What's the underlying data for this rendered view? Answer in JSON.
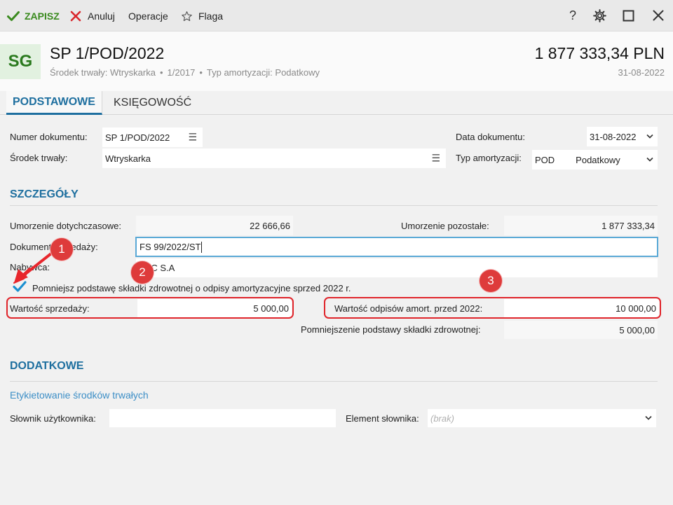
{
  "toolbar": {
    "save_label": "ZAPISZ",
    "cancel_label": "Anuluj",
    "operations_label": "Operacje",
    "flag_label": "Flaga",
    "help_label": "?"
  },
  "header": {
    "avatar_text": "SG",
    "title": "SP 1/POD/2022",
    "subtitle": {
      "asset": "Środek trwały: Wtryskarka",
      "period": "1/2017",
      "depreciation": "Typ amortyzacji: Podatkowy"
    },
    "amount": "1 877 333,34 PLN",
    "date": "31-08-2022"
  },
  "tabs": [
    {
      "label": "PODSTAWOWE",
      "active": true
    },
    {
      "label": "KSIĘGOWOŚĆ",
      "active": false
    }
  ],
  "form": {
    "doc_number_label": "Numer dokumentu:",
    "doc_number_value": "SP 1/POD/2022",
    "asset_label": "Środek trwały:",
    "asset_value": "Wtryskarka",
    "doc_date_label": "Data dokumentu:",
    "doc_date_value": "31-08-2022",
    "depr_type_label": "Typ amortyzacji:",
    "depr_type_code": "POD",
    "depr_type_value": "Podatkowy"
  },
  "details": {
    "section_title": "SZCZEGÓŁY",
    "depr_so_far_label": "Umorzenie dotychczasowe:",
    "depr_so_far_value": "22 666,66",
    "depr_remaining_label": "Umorzenie pozostałe:",
    "depr_remaining_value": "1 877 333,34",
    "sale_doc_label": "Dokument sprzedaży:",
    "sale_doc_value": "FS 99/2022/ST",
    "buyer_label": "Nabywca:",
    "buyer_value": "ABC S.A",
    "reduce_checkbox_label": "Pomniejsz podstawę składki zdrowotnej o odpisy amortyzacyjne sprzed 2022 r.",
    "reduce_checked": true,
    "sale_value_label": "Wartość sprzedaży:",
    "sale_value": "5 000,00",
    "pre2022_label": "Wartość odpisów amort. przed 2022:",
    "pre2022_value": "10 000,00",
    "health_reduction_label": "Pomniejszenie podstawy składki zdrowotnej:",
    "health_reduction_value": "5 000,00"
  },
  "additional": {
    "section_title": "DODATKOWE",
    "labeling_link": "Etykietowanie środków trwałych",
    "user_dict_label": "Słownik użytkownika:",
    "user_dict_value": "",
    "dict_element_label": "Element słownika:",
    "dict_element_placeholder": "(brak)"
  },
  "annotations": {
    "badge1": "1",
    "badge2": "2",
    "badge3": "3"
  },
  "colors": {
    "accent": "#1e6f9f",
    "save_green": "#3a8a1e",
    "cancel_red": "#d9262c",
    "annotation_red": "#e0252b",
    "check_blue": "#1a8fd0"
  }
}
